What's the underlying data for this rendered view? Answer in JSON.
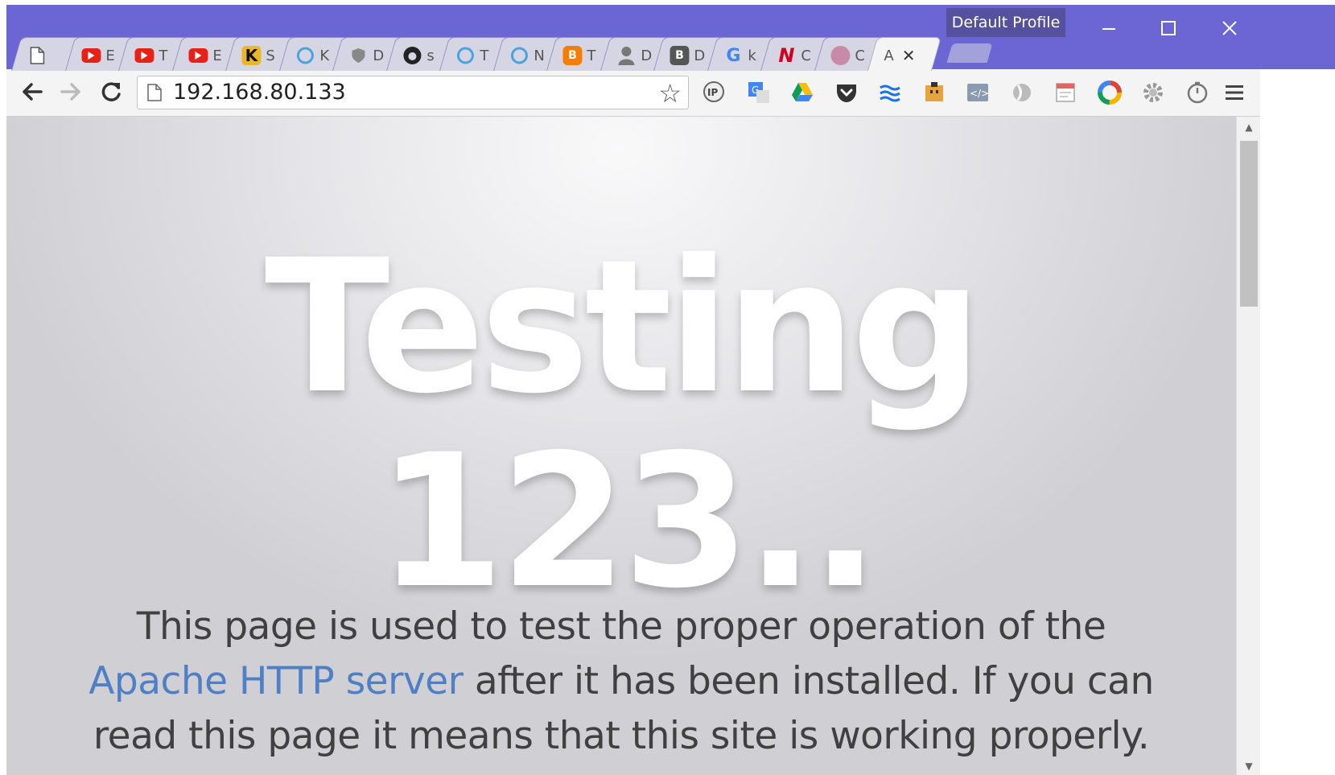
{
  "window": {
    "profile_label": "Default Profile",
    "chrome_color": "#6b66d4"
  },
  "tabs": [
    {
      "icon": "blank-page-icon",
      "letter": "",
      "color": "#ffffff"
    },
    {
      "icon": "youtube-icon",
      "letter": "E",
      "color": "#e62117"
    },
    {
      "icon": "youtube-icon",
      "letter": "T",
      "color": "#e62117"
    },
    {
      "icon": "youtube-icon",
      "letter": "E",
      "color": "#e62117"
    },
    {
      "icon": "k-icon",
      "letter": "S",
      "color": "#1d1d1d"
    },
    {
      "icon": "circle-icon",
      "letter": "K",
      "color": "#4aa3df"
    },
    {
      "icon": "shield-icon",
      "letter": "D",
      "color": "#888888"
    },
    {
      "icon": "github-icon",
      "letter": "s",
      "color": "#222222"
    },
    {
      "icon": "wordpress-icon",
      "letter": "T",
      "color": "#4aa3df"
    },
    {
      "icon": "u-icon",
      "letter": "N",
      "color": "#4aa3df"
    },
    {
      "icon": "blogger-icon",
      "letter": "T",
      "color": "#f57d00"
    },
    {
      "icon": "person-icon",
      "letter": "D",
      "color": "#777777"
    },
    {
      "icon": "b-icon",
      "letter": "D",
      "color": "#555555"
    },
    {
      "icon": "google-icon",
      "letter": "k",
      "color": "#4285f4"
    },
    {
      "icon": "n-icon",
      "letter": "C",
      "color": "#d0021b"
    },
    {
      "icon": "avatar-icon",
      "letter": "C",
      "color": "#c98aa8"
    },
    {
      "icon": "",
      "letter": "A",
      "color": "#333333",
      "active": true
    }
  ],
  "toolbar": {
    "url": "192.168.80.133",
    "extensions": [
      "ip-icon",
      "translate-icon",
      "drive-icon",
      "pocket-icon",
      "waves-icon",
      "box-icon",
      "code-icon",
      "drop-icon",
      "calendar-icon",
      "colorwheel-icon",
      "gear-icon",
      "timer-icon"
    ]
  },
  "page": {
    "hero_line1": "Testing",
    "hero_line2": "123..",
    "desc_line1": "This page is used to test the proper operation of the",
    "desc_link": "Apache HTTP server",
    "desc_line2_rest": " after it has been installed. If you can",
    "desc_line3": "read this page it means that this site is working properly."
  }
}
